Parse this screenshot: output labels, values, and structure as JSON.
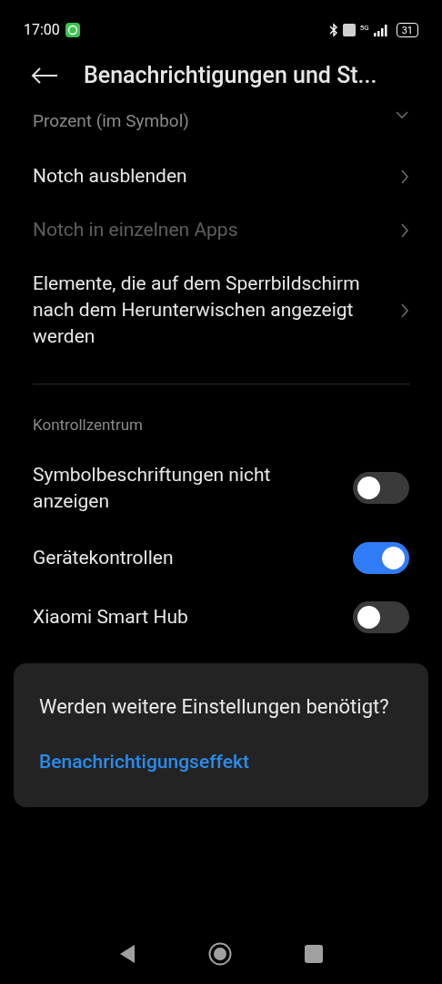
{
  "status_bar": {
    "time": "17:00",
    "network": "5G",
    "battery": "31"
  },
  "header": {
    "title": "Benachrichtigungen und St..."
  },
  "top_item": {
    "subtitle": "Prozent (im Symbol)"
  },
  "items": [
    {
      "kind": "nav",
      "label": "Notch ausblenden",
      "disabled": false
    },
    {
      "kind": "nav",
      "label": "Notch in einzelnen Apps",
      "disabled": true
    },
    {
      "kind": "nav",
      "label": "Elemente, die auf dem Sperrbildschirm nach dem Herunterwischen angezeigt werden",
      "disabled": false
    }
  ],
  "section": {
    "title": "Kontrollzentrum",
    "items": [
      {
        "kind": "toggle",
        "label": "Symbolbeschriftungen nicht anzeigen",
        "on": false
      },
      {
        "kind": "toggle",
        "label": "Gerätekontrollen",
        "on": true
      },
      {
        "kind": "toggle",
        "label": "Xiaomi Smart Hub",
        "on": false
      }
    ]
  },
  "card": {
    "question": "Werden weitere Einstellungen benötigt?",
    "link": "Benachrichtigungseffekt"
  }
}
